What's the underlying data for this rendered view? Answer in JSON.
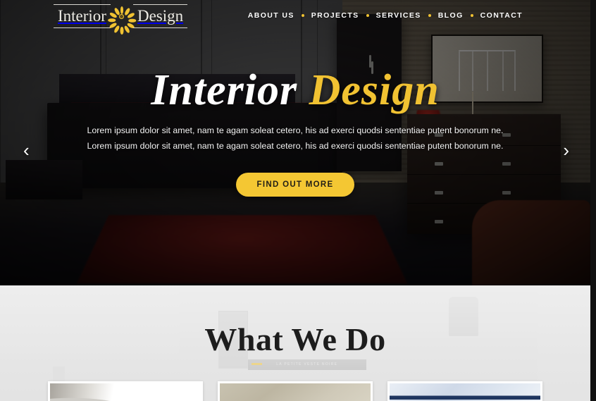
{
  "brand": {
    "word_one": "Interior",
    "word_two": "Design",
    "flower_icon": "flower-icon"
  },
  "nav": {
    "items": [
      {
        "label": "ABOUT US"
      },
      {
        "label": "PROJECTS"
      },
      {
        "label": "SERVICES"
      },
      {
        "label": "BLOG"
      },
      {
        "label": "CONTACT"
      }
    ],
    "separator": "dot-separator"
  },
  "hero": {
    "title_white": "Interior",
    "title_accent": "Design",
    "subtitle": "Lorem ipsum dolor sit amet, nam te agam soleat cetero, his ad exerci quodsi sententiae putent bonorum ne. Lorem ipsum dolor sit amet, nam te agam soleat cetero, his ad exerci quodsi sententiae putent bonorum ne.",
    "cta_label": "FIND OUT MORE",
    "prev_arrow": "‹",
    "next_arrow": "›"
  },
  "what_we_do": {
    "title": "What We Do",
    "background_book_text": "LA PETITE VESTE NOIRE",
    "cards": [
      {
        "name": "card-one"
      },
      {
        "name": "card-two"
      },
      {
        "name": "card-three"
      }
    ]
  },
  "colors": {
    "accent_yellow": "#f1c232",
    "nav_text": "#ffffff",
    "section_bg": "#e9e9e9",
    "heading_dark": "#1d1d1d",
    "cta_bg": "#f4c733",
    "cta_text": "#231f16"
  }
}
